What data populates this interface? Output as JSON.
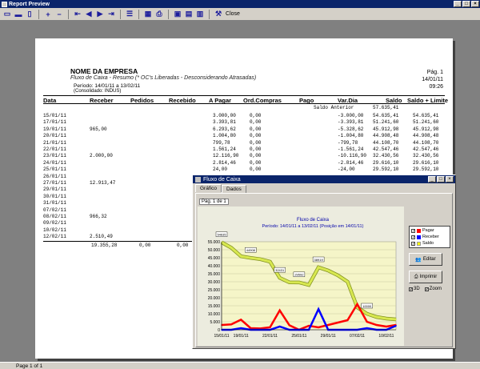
{
  "window": {
    "title": "Report Preview",
    "close_label": "Close",
    "status": "Page 1 of 1"
  },
  "report": {
    "company": "NOME DA EMPRESA",
    "subtitle": "Fluxo de Caixa - Resumo (* OC's Liberadas - Desconsiderando Atrasadas)",
    "period": "Período:  14/01/11 a 13/02/11",
    "consolidated": "(Consolidado: INDUS)",
    "page": "Pág. 1",
    "date": "14/01/11",
    "time": "09:26",
    "headers": [
      "Data",
      "Receber",
      "Pedidos",
      "Recebido",
      "A Pagar",
      "Ord.Compras",
      "Pago",
      "Var.Dia",
      "Saldo",
      "Saldo + Limite"
    ],
    "saldo_anterior_label": "Saldo Anterior",
    "saldo_anterior_value": "57.635,41",
    "rows": [
      [
        "15/01/11",
        "",
        "",
        "",
        "3.000,00",
        "0,00",
        "",
        "-3.000,00",
        "54.635,41",
        "54.635,41"
      ],
      [
        "17/01/11",
        "",
        "",
        "",
        "3.393,81",
        "0,00",
        "",
        "-3.393,81",
        "51.241,60",
        "51.241,60"
      ],
      [
        "19/01/11",
        "965,00",
        "",
        "",
        "6.293,62",
        "0,00",
        "",
        "-5.328,62",
        "45.912,98",
        "45.912,98"
      ],
      [
        "20/01/11",
        "",
        "",
        "",
        "1.004,80",
        "0,00",
        "",
        "-1.004,80",
        "44.908,48",
        "44.908,48"
      ],
      [
        "21/01/11",
        "",
        "",
        "",
        "799,78",
        "0,00",
        "",
        "-799,78",
        "44.108,70",
        "44.108,70"
      ],
      [
        "22/01/11",
        "",
        "",
        "",
        "1.561,24",
        "0,00",
        "",
        "-1.561,24",
        "42.547,46",
        "42.547,46"
      ],
      [
        "23/01/11",
        "2.000,00",
        "",
        "",
        "12.116,90",
        "0,00",
        "",
        "-10.116,90",
        "32.430,56",
        "32.430,56"
      ],
      [
        "24/01/11",
        "",
        "",
        "",
        "2.814,46",
        "0,00",
        "",
        "-2.814,46",
        "29.616,10",
        "29.616,10"
      ],
      [
        "25/01/11",
        "",
        "",
        "",
        "24,00",
        "0,00",
        "",
        "-24,00",
        "29.592,10",
        "29.592,10"
      ],
      [
        "26/01/11",
        "",
        "",
        "",
        "",
        "",
        "",
        "",
        "",
        ""
      ],
      [
        "27/01/11",
        "12.913,47",
        "",
        "",
        "",
        "",
        "",
        "",
        "",
        ""
      ],
      [
        "29/01/11",
        "",
        "",
        "",
        "",
        "",
        "",
        "",
        "",
        ""
      ],
      [
        "30/01/11",
        "",
        "",
        "",
        "",
        "",
        "",
        "",
        "",
        ""
      ],
      [
        "31/01/11",
        "",
        "",
        "",
        "",
        "",
        "",
        "",
        "",
        ""
      ],
      [
        "07/02/11",
        "",
        "",
        "",
        "",
        "",
        "",
        "",
        "",
        ""
      ],
      [
        "08/02/11",
        "966,32",
        "",
        "",
        "",
        "",
        "",
        "",
        "",
        ""
      ],
      [
        "09/02/11",
        "",
        "",
        "",
        "",
        "",
        "",
        "",
        "",
        ""
      ],
      [
        "10/02/11",
        "",
        "",
        "",
        "",
        "",
        "",
        "",
        "",
        ""
      ],
      [
        "12/02/11",
        "2.510,49",
        "",
        "",
        "",
        "",
        "",
        "",
        "",
        ""
      ]
    ],
    "totals": [
      "19.355,28",
      "0,00",
      "0,00"
    ]
  },
  "dialog": {
    "title": "Fluxo de Caixa",
    "tabs": [
      "Gráfico",
      "Dados"
    ],
    "page_indicator": "Pág. 1 de 1",
    "edit_label": "Editar",
    "print_label": "Imprimir",
    "opt_3d": "3D",
    "opt_zoom": "Zoom"
  },
  "colors": {
    "pagar": "#ff0000",
    "receber": "#0000ff",
    "saldo": "#ffff00",
    "accent": "#0a246a"
  },
  "chart_data": {
    "type": "line",
    "title": "Fluxo de Caixa",
    "subtitle": "Período: 14/01/11 a 13/02/11  (Posição em 14/01/11)",
    "ylim": [
      0,
      55000
    ],
    "yticks": [
      "0",
      "5.000",
      "10.000",
      "15.000",
      "20.000",
      "25.000",
      "30.000",
      "35.000",
      "40.000",
      "45.000",
      "50.000",
      "55.000"
    ],
    "xticks": [
      "15/01/11",
      "19/01/11",
      "22/01/11",
      "25/01/11",
      "29/01/11",
      "07/02/11",
      "10/02/11"
    ],
    "x": [
      "15/01/11",
      "17/01/11",
      "19/01/11",
      "20/01/11",
      "21/01/11",
      "22/01/11",
      "23/01/11",
      "24/01/11",
      "25/01/11",
      "26/01/11",
      "27/01/11",
      "29/01/11",
      "30/01/11",
      "31/01/11",
      "07/02/11",
      "08/02/11",
      "09/02/11",
      "10/02/11",
      "12/02/11"
    ],
    "series": [
      {
        "name": "Pagar",
        "values": [
          3000,
          3394,
          6294,
          1005,
          800,
          1561,
          12117,
          2814,
          24,
          2500,
          1500,
          3000,
          4500,
          6000,
          16000,
          5000,
          3000,
          2000,
          3000
        ]
      },
      {
        "name": "Receber",
        "values": [
          0,
          0,
          965,
          0,
          0,
          0,
          2000,
          0,
          0,
          0,
          12913,
          0,
          0,
          0,
          0,
          966,
          0,
          0,
          2510
        ]
      },
      {
        "name": "Saldo",
        "values": [
          54635,
          51242,
          45913,
          44908,
          44109,
          42547,
          32431,
          29616,
          29592,
          28000,
          39000,
          37000,
          34000,
          30000,
          14000,
          10000,
          8000,
          7000,
          6500
        ]
      }
    ],
    "legend": [
      "Pagar",
      "Receber",
      "Saldo"
    ],
    "point_labels": [
      "54635",
      "44908",
      "32431",
      "29592",
      "38919",
      "10000"
    ]
  }
}
